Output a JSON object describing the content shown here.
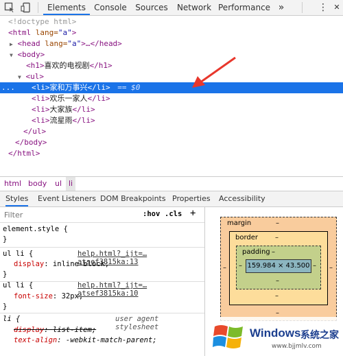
{
  "toolbar": {
    "tabs": [
      "Elements",
      "Console",
      "Sources",
      "Network",
      "Performance"
    ],
    "more": "»",
    "menu": "⋮",
    "close": "✕"
  },
  "dom": {
    "doctype": "<!doctype html>",
    "html_open_tag": "<html",
    "html_lang_attr": " lang=",
    "html_lang_val": "\"a\"",
    "html_close_bracket": ">",
    "head_tag": "<head",
    "head_lang_attr": " lang=",
    "head_lang_val": "\"a\"",
    "head_rest": ">…</head>",
    "body_open": "<body>",
    "h1_open": "<h1>",
    "h1_text": "喜欢的电视剧",
    "h1_close": "</h1>",
    "ul_open": "<ul>",
    "li_open": "<li>",
    "li_close": "</li>",
    "items": [
      "家和万事兴",
      "欢乐一家人",
      "大家族",
      "流星雨"
    ],
    "selected_suffix": "== $0",
    "dots": "...",
    "ul_close": "</ul>",
    "body_close": "</body>",
    "html_close": "</html>"
  },
  "breadcrumbs": [
    "html",
    "body",
    "ul",
    "li"
  ],
  "subtabs": [
    "Styles",
    "Event Listeners",
    "DOM Breakpoints",
    "Properties",
    "Accessibility"
  ],
  "filter": {
    "placeholder": "Filter",
    "hov": ":hov",
    "cls": ".cls",
    "plus": "+"
  },
  "rules": [
    {
      "selector": "element.style {",
      "source": "",
      "props": [],
      "close": "}"
    },
    {
      "selector": "ul li {",
      "source": "help.html?_ijt=…atsef3815ka:13",
      "props": [
        {
          "name": "display",
          "value": "inline-block;"
        }
      ],
      "close": "}"
    },
    {
      "selector": "ul li {",
      "source": "help.html?_ijt=…atsef3815ka:10",
      "props": [
        {
          "name": "font-size",
          "value": "32px;"
        }
      ],
      "close": "}"
    },
    {
      "selector": "li {",
      "source": "user agent stylesheet",
      "props": [
        {
          "name": "display",
          "value": "list-item;"
        },
        {
          "name": "text-align",
          "value": "-webkit-match-parent;"
        }
      ],
      "close": ""
    }
  ],
  "boxmodel": {
    "margin_label": "margin",
    "margin_val": "–",
    "border_label": "border",
    "border_val": "–",
    "padding_label": "padding",
    "padding_val": "–",
    "content": "159.984 × 43.500",
    "side_dash": "–"
  },
  "watermark": {
    "windows": "Windows",
    "cn": "系统之家",
    "url": "www.bjjmlv.com"
  },
  "colors": {
    "accent": "#1a73e8",
    "margin": "#f9cc9d",
    "border": "#fddd9b",
    "padding": "#c3d08b",
    "content": "#8cb6c0",
    "arrow": "#e8372c"
  }
}
